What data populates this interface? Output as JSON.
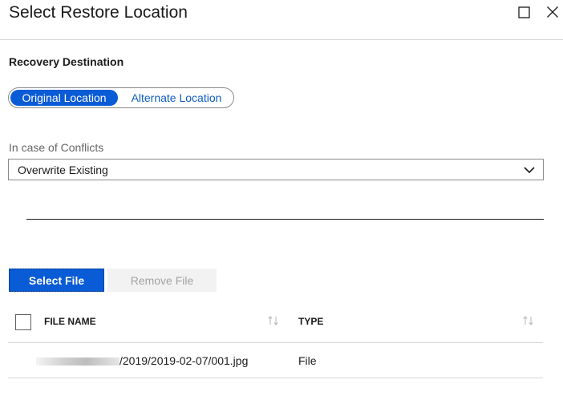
{
  "header": {
    "title": "Select Restore Location",
    "maximize_icon": "maximize-icon",
    "close_icon": "close-icon"
  },
  "recovery": {
    "label": "Recovery Destination",
    "options": [
      {
        "label": "Original Location",
        "selected": true
      },
      {
        "label": "Alternate Location",
        "selected": false
      }
    ]
  },
  "conflicts": {
    "label": "In case of Conflicts",
    "value": "Overwrite Existing",
    "chevron_icon": "chevron-down-icon"
  },
  "toolbar": {
    "select_file_label": "Select File",
    "remove_file_label": "Remove File"
  },
  "table": {
    "columns": [
      {
        "label": "FILE NAME",
        "sort_icon": "sort-icon"
      },
      {
        "label": "TYPE",
        "sort_icon": "sort-icon"
      }
    ],
    "rows": [
      {
        "file_name": "/2019/2019-02-07/001.jpg",
        "type": "File"
      }
    ]
  },
  "colors": {
    "accent": "#0a5bd6",
    "link": "#0f5dbf",
    "disabled_bg": "#f2f2f2",
    "disabled_text": "#a3a3a3"
  }
}
